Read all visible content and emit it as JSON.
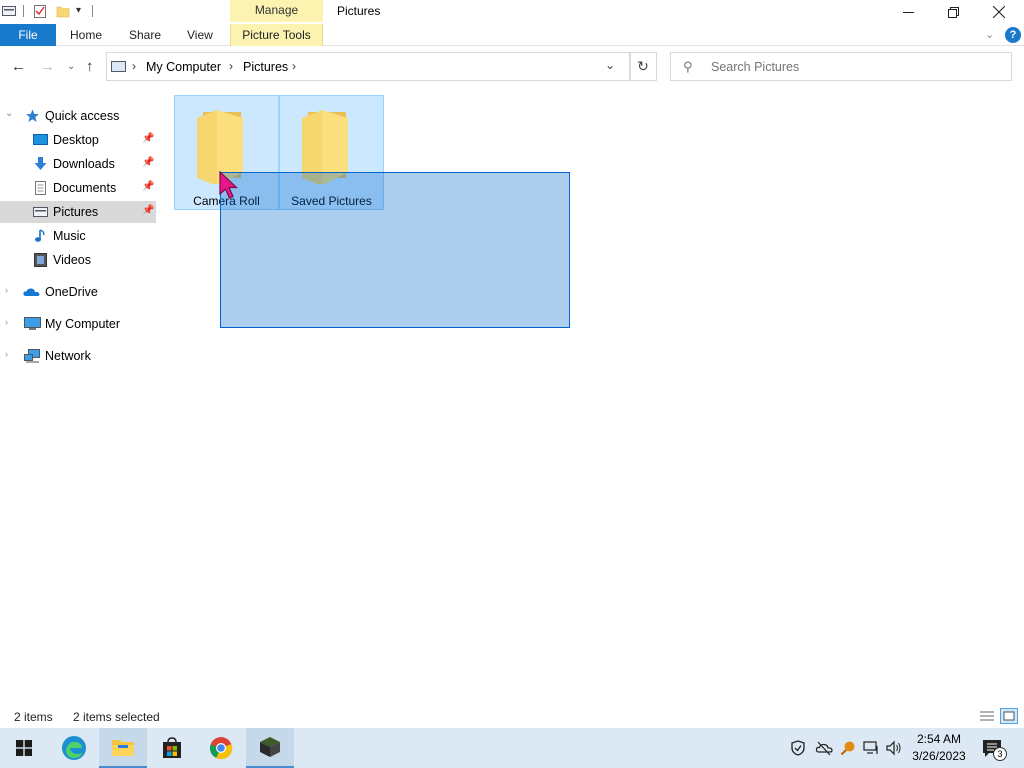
{
  "window": {
    "title": "Pictures",
    "contextual_group": "Manage"
  },
  "ribbon": {
    "tabs": [
      "File",
      "Home",
      "Share",
      "View",
      "Picture Tools"
    ]
  },
  "address": {
    "crumbs": [
      "My Computer",
      "Pictures"
    ]
  },
  "search": {
    "placeholder": "Search Pictures"
  },
  "sidebar": {
    "quick_access": "Quick access",
    "items": [
      {
        "label": "Desktop",
        "icon": "desktop-icon",
        "pinned": true
      },
      {
        "label": "Downloads",
        "icon": "downloads-icon",
        "pinned": true
      },
      {
        "label": "Documents",
        "icon": "documents-icon",
        "pinned": true
      },
      {
        "label": "Pictures",
        "icon": "pictures-icon",
        "pinned": true,
        "selected": true
      },
      {
        "label": "Music",
        "icon": "music-icon",
        "pinned": false
      },
      {
        "label": "Videos",
        "icon": "videos-icon",
        "pinned": false
      }
    ],
    "onedrive": "OneDrive",
    "my_computer": "My Computer",
    "network": "Network"
  },
  "folders": [
    {
      "name": "Camera Roll",
      "selected": true
    },
    {
      "name": "Saved Pictures",
      "selected": true
    }
  ],
  "status": {
    "item_count": "2 items",
    "selected_count": "2 items selected"
  },
  "taskbar": {
    "apps": [
      "start-icon",
      "edge-icon",
      "file-explorer-icon",
      "store-icon",
      "chrome-icon",
      "minecraft-icon"
    ],
    "tray_icons": [
      "security-icon",
      "onedrive-offline-icon",
      "search-tray-icon",
      "network-icon",
      "volume-icon"
    ],
    "time": "2:54 AM",
    "date": "3/26/2023",
    "notification_count": "3"
  },
  "colors": {
    "accent": "#1979ca",
    "contextual_tab": "#fcf3b0",
    "selection": "#cce8ff",
    "taskbar": "#dce8f3"
  }
}
